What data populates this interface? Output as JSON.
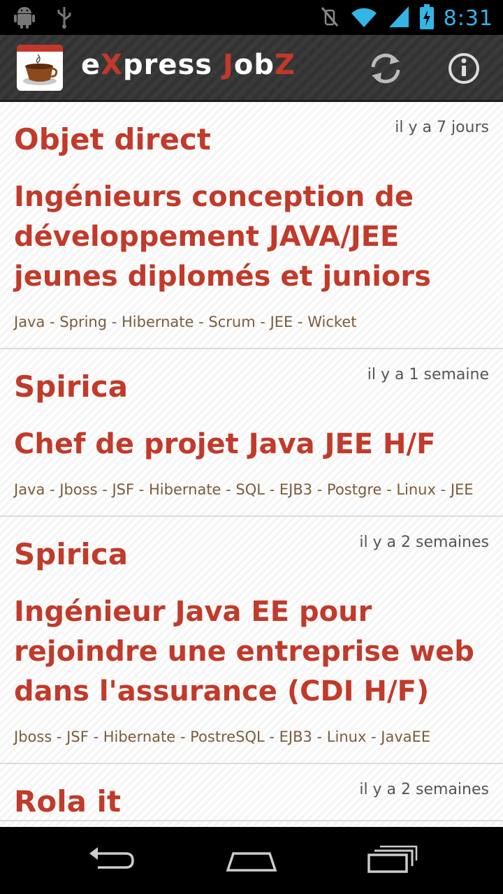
{
  "status_bar": {
    "time": "8:31",
    "icons": [
      "android-icon",
      "usb-icon",
      "mute-icon",
      "wifi-icon",
      "signal-icon",
      "battery-charging-icon"
    ]
  },
  "action_bar": {
    "title_parts": [
      "e",
      "X",
      "press ",
      "J",
      "ob",
      "Z"
    ],
    "refresh_icon": "refresh-icon",
    "info_icon": "info-icon"
  },
  "jobs": [
    {
      "company": "Objet direct",
      "date": "il y a 7 jours",
      "title": "Ingénieurs conception de développement JAVA/JEE jeunes diplomés et juniors",
      "tags": "Java - Spring - Hibernate - Scrum - JEE - Wicket"
    },
    {
      "company": "Spirica",
      "date": "il y a 1 semaine",
      "title": "Chef de projet Java JEE H/F",
      "tags": "Java - Jboss - JSF - Hibernate - SQL - EJB3 - Postgre - Linux - JEE"
    },
    {
      "company": "Spirica",
      "date": "il y a 2 semaines",
      "title": "Ingénieur Java EE pour rejoindre une entreprise web dans l'assurance (CDI H/F)",
      "tags": "Jboss - JSF - Hibernate - PostreSQL - EJB3 - Linux - JavaEE"
    },
    {
      "company": "Rola it",
      "date": "il y a 2 semaines",
      "title": "",
      "tags": ""
    }
  ],
  "nav_bar": {
    "icons": [
      "back-icon",
      "home-icon",
      "recent-apps-icon"
    ]
  },
  "colors": {
    "accent": "#c13a2a",
    "tag_text": "#7a5c3a",
    "status_blue": "#33b5e5"
  }
}
